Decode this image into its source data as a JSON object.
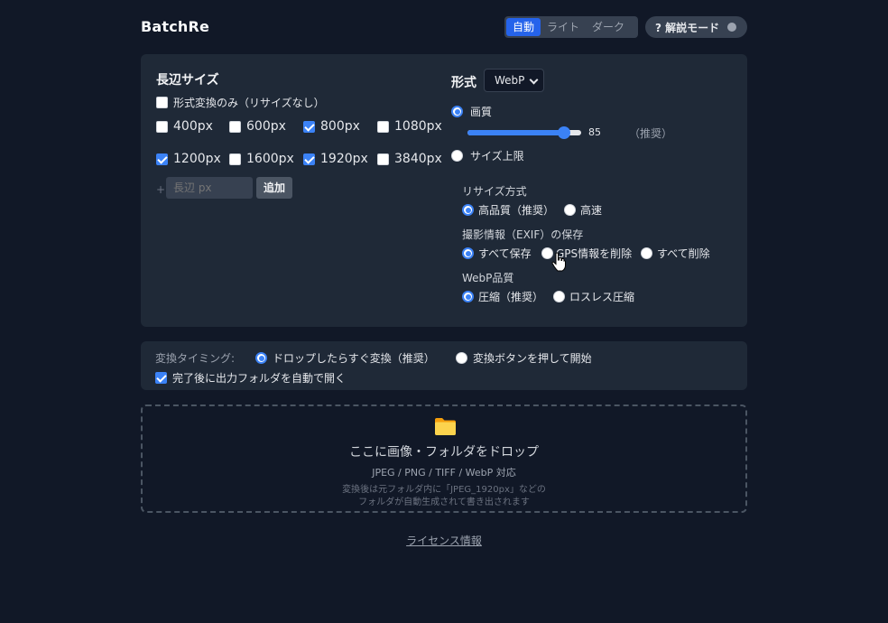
{
  "app": {
    "title": "BatchRe"
  },
  "theme": {
    "options": [
      "自動",
      "ライト",
      "ダーク"
    ],
    "selected": "自動"
  },
  "help_mode": {
    "label": "? 解説モード",
    "on": false
  },
  "long_side": {
    "title": "長辺サイズ",
    "format_only": {
      "label": "形式変換のみ（リサイズなし）",
      "checked": false
    },
    "sizes": [
      {
        "label": "400px",
        "checked": false
      },
      {
        "label": "600px",
        "checked": false
      },
      {
        "label": "800px",
        "checked": true
      },
      {
        "label": "1080px",
        "checked": false
      },
      {
        "label": "1200px",
        "checked": true
      },
      {
        "label": "1600px",
        "checked": false
      },
      {
        "label": "1920px",
        "checked": true
      },
      {
        "label": "3840px",
        "checked": false
      }
    ],
    "add": {
      "plus": "+",
      "placeholder": "長辺 px",
      "button": "追加"
    }
  },
  "format": {
    "title": "形式",
    "selected": "WebP",
    "quality": {
      "label": "画質",
      "value": "85",
      "hint": "（推奨）",
      "fraction": 0.85
    },
    "size_limit": {
      "label": "サイズ上限"
    }
  },
  "resize_method": {
    "title": "リサイズ方式",
    "options": [
      "高品質（推奨）",
      "高速"
    ],
    "selected": 0
  },
  "exif": {
    "title": "撮影情報（EXIF）の保存",
    "options": [
      "すべて保存",
      "GPS情報を削除",
      "すべて削除"
    ],
    "selected": 0
  },
  "webp_quality": {
    "title": "WebP品質",
    "options": [
      "圧縮（推奨）",
      "ロスレス圧縮"
    ],
    "selected": 0
  },
  "timing": {
    "label": "変換タイミング:",
    "options": [
      "ドロップしたらすぐ変換（推奨）",
      "変換ボタンを押して開始"
    ],
    "selected": 0,
    "open_folder": {
      "label": "完了後に出力フォルダを自動で開く",
      "checked": true
    }
  },
  "dropzone": {
    "title": "ここに画像・フォルダをドロップ",
    "formats": "JPEG / PNG / TIFF / WebP 対応",
    "note_line1": "変換後は元フォルダ内に「JPEG_1920px」などの",
    "note_line2": "フォルダが自動生成されて書き出されます"
  },
  "footer": {
    "license": "ライセンス情報"
  },
  "colors": {
    "bg": "#111827",
    "panel": "#1f2937",
    "accent": "#3b82f6",
    "folder": "#fbbf24"
  }
}
